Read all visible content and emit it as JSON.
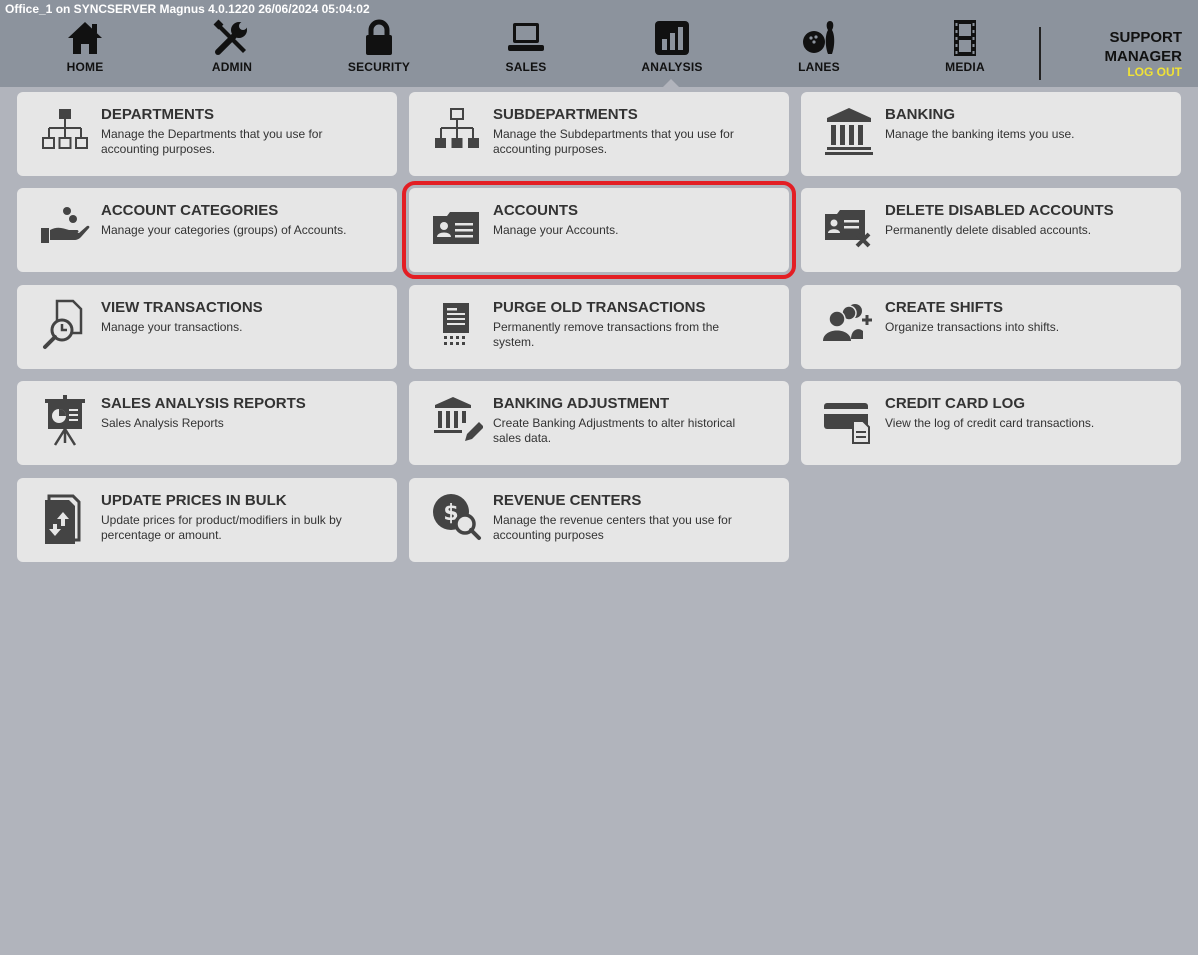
{
  "window": {
    "title": "Office_1 on SYNCSERVER Magnus 4.0.1220 26/06/2024 05:04:02"
  },
  "nav": {
    "items": [
      {
        "label": "HOME",
        "icon": "home-icon"
      },
      {
        "label": "ADMIN",
        "icon": "tools-icon"
      },
      {
        "label": "SECURITY",
        "icon": "lock-icon"
      },
      {
        "label": "SALES",
        "icon": "laptop-icon"
      },
      {
        "label": "ANALYSIS",
        "icon": "bar-chart-icon",
        "active": true
      },
      {
        "label": "LANES",
        "icon": "bowling-icon"
      },
      {
        "label": "MEDIA",
        "icon": "film-icon"
      }
    ]
  },
  "user": {
    "line1": "SUPPORT",
    "line2": "MANAGER",
    "logout": "LOG OUT"
  },
  "tiles": [
    {
      "title": "DEPARTMENTS",
      "desc": "Manage the Departments that you use for accounting purposes.",
      "icon": "org-chart-outline-icon"
    },
    {
      "title": "SUBDEPARTMENTS",
      "desc": "Manage the Subdepartments that you use for accounting purposes.",
      "icon": "org-chart-filled-icon"
    },
    {
      "title": "BANKING",
      "desc": "Manage the banking items you use.",
      "icon": "bank-icon"
    },
    {
      "title": "ACCOUNT CATEGORIES",
      "desc": "Manage your categories (groups) of Accounts.",
      "icon": "hand-coins-icon"
    },
    {
      "title": "ACCOUNTS",
      "desc": "Manage your Accounts.",
      "icon": "id-card-icon",
      "selected": true
    },
    {
      "title": "DELETE DISABLED ACCOUNTS",
      "desc": "Permanently delete disabled accounts.",
      "icon": "id-card-delete-icon"
    },
    {
      "title": "VIEW TRANSACTIONS",
      "desc": "Manage your transactions.",
      "icon": "document-search-icon"
    },
    {
      "title": "PURGE OLD TRANSACTIONS",
      "desc": "Permanently remove transactions from the system.",
      "icon": "receipt-shred-icon"
    },
    {
      "title": "CREATE SHIFTS",
      "desc": "Organize transactions into shifts.",
      "icon": "users-add-icon"
    },
    {
      "title": "SALES ANALYSIS REPORTS",
      "desc": "Sales Analysis Reports",
      "icon": "presentation-icon"
    },
    {
      "title": "BANKING ADJUSTMENT",
      "desc": "Create Banking Adjustments to alter historical sales data.",
      "icon": "bank-edit-icon"
    },
    {
      "title": "CREDIT CARD LOG",
      "desc": "View the log of credit card transactions.",
      "icon": "credit-card-log-icon"
    },
    {
      "title": "UPDATE PRICES IN BULK",
      "desc": "Update prices for product/modifiers in bulk by percentage or amount.",
      "icon": "price-update-icon"
    },
    {
      "title": "REVENUE CENTERS",
      "desc": "Manage the revenue centers that you use for accounting purposes",
      "icon": "money-search-icon"
    }
  ]
}
